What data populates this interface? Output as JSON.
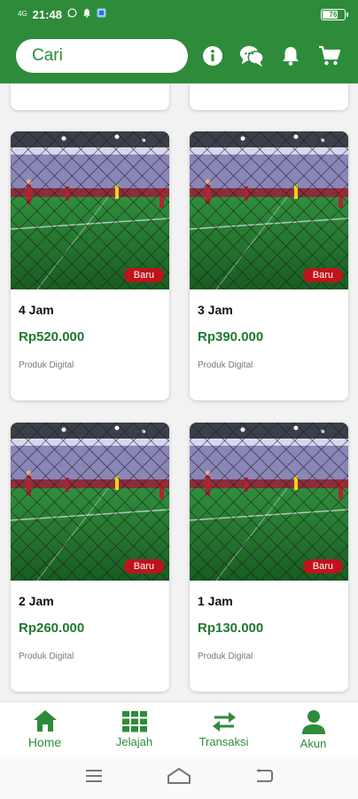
{
  "status_bar": {
    "network": "4G",
    "time": "21:48",
    "battery": "76",
    "battery_level": 0.76
  },
  "header": {
    "search_placeholder": "Cari"
  },
  "products": [
    {
      "title": "4 Jam",
      "price": "Rp520.000",
      "type": "Produk Digital",
      "badge": "Baru"
    },
    {
      "title": "3 Jam",
      "price": "Rp390.000",
      "type": "Produk Digital",
      "badge": "Baru"
    },
    {
      "title": "2 Jam",
      "price": "Rp260.000",
      "type": "Produk Digital",
      "badge": "Baru"
    },
    {
      "title": "1 Jam",
      "price": "Rp130.000",
      "type": "Produk Digital",
      "badge": "Baru"
    }
  ],
  "bottom_nav": [
    {
      "label": "Home",
      "icon": "home-icon",
      "active": true
    },
    {
      "label": "Jelajah",
      "icon": "grid-icon",
      "active": false
    },
    {
      "label": "Transaksi",
      "icon": "swap-arrows-icon",
      "active": false
    },
    {
      "label": "Akun",
      "icon": "account-icon",
      "active": false
    }
  ],
  "colors": {
    "primary": "#2e8b3a",
    "price": "#1f7a2e",
    "badge": "#c0131b"
  }
}
